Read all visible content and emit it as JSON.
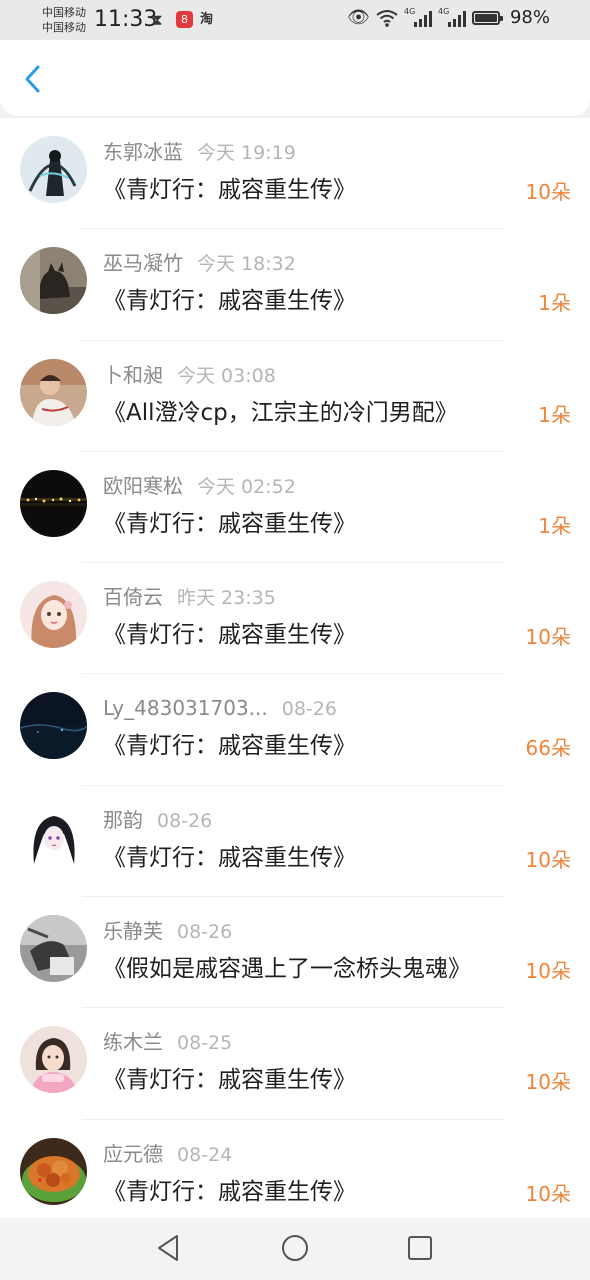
{
  "status_bar": {
    "carrier_1": "中国移动",
    "carrier_2": "中国移动",
    "time": "11:33",
    "taobao_icon_text": "淘",
    "network_tag_1": "4G",
    "network_tag_2": "4G",
    "battery": "98%",
    "battery_level": 0.98
  },
  "header": {
    "back_icon": "chevron-left-icon",
    "accent": "#2b9bea"
  },
  "gifts": [
    {
      "name": "东郭冰蓝",
      "time": "今天 19:19",
      "book": "《青灯行：戚容重生传》",
      "amount": "10朵",
      "avatar": "dark-figure"
    },
    {
      "name": "巫马凝竹",
      "time": "今天 18:32",
      "book": "《青灯行：戚容重生传》",
      "amount": "1朵",
      "avatar": "cat-photo"
    },
    {
      "name": "卜和昶",
      "time": "今天 03:08",
      "book": "《All澄冷cp，江宗主的冷门男配》",
      "amount": "1朵",
      "avatar": "child-photo"
    },
    {
      "name": "欧阳寒松",
      "time": "今天 02:52",
      "book": "《青灯行：戚容重生传》",
      "amount": "1朵",
      "avatar": "night-city"
    },
    {
      "name": "百倚云",
      "time": "昨天 23:35",
      "book": "《青灯行：戚容重生传》",
      "amount": "10朵",
      "avatar": "anime-girl"
    },
    {
      "name": "Ly_483031703...",
      "time": "08-26",
      "book": "《青灯行：戚容重生传》",
      "amount": "66朵",
      "avatar": "night-sky"
    },
    {
      "name": "那韵",
      "time": "08-26",
      "book": "《青灯行：戚容重生传》",
      "amount": "10朵",
      "avatar": "dark-hair-girl"
    },
    {
      "name": "乐静芙",
      "time": "08-26",
      "book": "《假如是戚容遇上了一念桥头鬼魂》",
      "amount": "10朵",
      "avatar": "bw-photo"
    },
    {
      "name": "练木兰",
      "time": "08-25",
      "book": "《青灯行：戚容重生传》",
      "amount": "10朵",
      "avatar": "little-girl"
    },
    {
      "name": "应元德",
      "time": "08-24",
      "book": "《青灯行：戚容重生传》",
      "amount": "10朵",
      "avatar": "food-bowl"
    }
  ],
  "colors": {
    "amount": "#f0843a",
    "name": "#8a8a8a",
    "time": "#b5b5b5",
    "book": "#1f1f1f"
  },
  "nav_bar": {
    "back": "triangle-back-icon",
    "home": "circle-home-icon",
    "recent": "square-recent-icon"
  }
}
